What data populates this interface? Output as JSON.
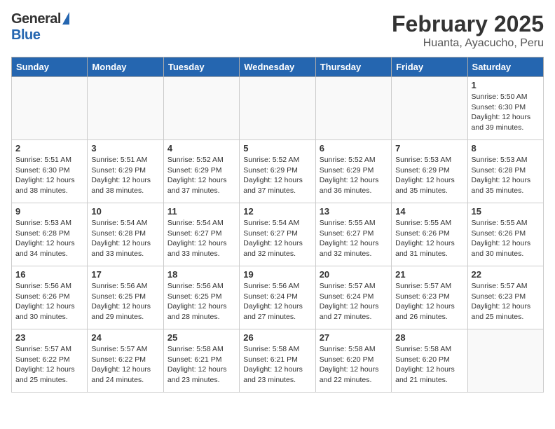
{
  "header": {
    "logo_general": "General",
    "logo_blue": "Blue",
    "month": "February 2025",
    "location": "Huanta, Ayacucho, Peru"
  },
  "days_of_week": [
    "Sunday",
    "Monday",
    "Tuesday",
    "Wednesday",
    "Thursday",
    "Friday",
    "Saturday"
  ],
  "weeks": [
    [
      {
        "day": "",
        "text": ""
      },
      {
        "day": "",
        "text": ""
      },
      {
        "day": "",
        "text": ""
      },
      {
        "day": "",
        "text": ""
      },
      {
        "day": "",
        "text": ""
      },
      {
        "day": "",
        "text": ""
      },
      {
        "day": "1",
        "text": "Sunrise: 5:50 AM\nSunset: 6:30 PM\nDaylight: 12 hours and 39 minutes."
      }
    ],
    [
      {
        "day": "2",
        "text": "Sunrise: 5:51 AM\nSunset: 6:30 PM\nDaylight: 12 hours and 38 minutes."
      },
      {
        "day": "3",
        "text": "Sunrise: 5:51 AM\nSunset: 6:29 PM\nDaylight: 12 hours and 38 minutes."
      },
      {
        "day": "4",
        "text": "Sunrise: 5:52 AM\nSunset: 6:29 PM\nDaylight: 12 hours and 37 minutes."
      },
      {
        "day": "5",
        "text": "Sunrise: 5:52 AM\nSunset: 6:29 PM\nDaylight: 12 hours and 37 minutes."
      },
      {
        "day": "6",
        "text": "Sunrise: 5:52 AM\nSunset: 6:29 PM\nDaylight: 12 hours and 36 minutes."
      },
      {
        "day": "7",
        "text": "Sunrise: 5:53 AM\nSunset: 6:29 PM\nDaylight: 12 hours and 35 minutes."
      },
      {
        "day": "8",
        "text": "Sunrise: 5:53 AM\nSunset: 6:28 PM\nDaylight: 12 hours and 35 minutes."
      }
    ],
    [
      {
        "day": "9",
        "text": "Sunrise: 5:53 AM\nSunset: 6:28 PM\nDaylight: 12 hours and 34 minutes."
      },
      {
        "day": "10",
        "text": "Sunrise: 5:54 AM\nSunset: 6:28 PM\nDaylight: 12 hours and 33 minutes."
      },
      {
        "day": "11",
        "text": "Sunrise: 5:54 AM\nSunset: 6:27 PM\nDaylight: 12 hours and 33 minutes."
      },
      {
        "day": "12",
        "text": "Sunrise: 5:54 AM\nSunset: 6:27 PM\nDaylight: 12 hours and 32 minutes."
      },
      {
        "day": "13",
        "text": "Sunrise: 5:55 AM\nSunset: 6:27 PM\nDaylight: 12 hours and 32 minutes."
      },
      {
        "day": "14",
        "text": "Sunrise: 5:55 AM\nSunset: 6:26 PM\nDaylight: 12 hours and 31 minutes."
      },
      {
        "day": "15",
        "text": "Sunrise: 5:55 AM\nSunset: 6:26 PM\nDaylight: 12 hours and 30 minutes."
      }
    ],
    [
      {
        "day": "16",
        "text": "Sunrise: 5:56 AM\nSunset: 6:26 PM\nDaylight: 12 hours and 30 minutes."
      },
      {
        "day": "17",
        "text": "Sunrise: 5:56 AM\nSunset: 6:25 PM\nDaylight: 12 hours and 29 minutes."
      },
      {
        "day": "18",
        "text": "Sunrise: 5:56 AM\nSunset: 6:25 PM\nDaylight: 12 hours and 28 minutes."
      },
      {
        "day": "19",
        "text": "Sunrise: 5:56 AM\nSunset: 6:24 PM\nDaylight: 12 hours and 27 minutes."
      },
      {
        "day": "20",
        "text": "Sunrise: 5:57 AM\nSunset: 6:24 PM\nDaylight: 12 hours and 27 minutes."
      },
      {
        "day": "21",
        "text": "Sunrise: 5:57 AM\nSunset: 6:23 PM\nDaylight: 12 hours and 26 minutes."
      },
      {
        "day": "22",
        "text": "Sunrise: 5:57 AM\nSunset: 6:23 PM\nDaylight: 12 hours and 25 minutes."
      }
    ],
    [
      {
        "day": "23",
        "text": "Sunrise: 5:57 AM\nSunset: 6:22 PM\nDaylight: 12 hours and 25 minutes."
      },
      {
        "day": "24",
        "text": "Sunrise: 5:57 AM\nSunset: 6:22 PM\nDaylight: 12 hours and 24 minutes."
      },
      {
        "day": "25",
        "text": "Sunrise: 5:58 AM\nSunset: 6:21 PM\nDaylight: 12 hours and 23 minutes."
      },
      {
        "day": "26",
        "text": "Sunrise: 5:58 AM\nSunset: 6:21 PM\nDaylight: 12 hours and 23 minutes."
      },
      {
        "day": "27",
        "text": "Sunrise: 5:58 AM\nSunset: 6:20 PM\nDaylight: 12 hours and 22 minutes."
      },
      {
        "day": "28",
        "text": "Sunrise: 5:58 AM\nSunset: 6:20 PM\nDaylight: 12 hours and 21 minutes."
      },
      {
        "day": "",
        "text": ""
      }
    ]
  ]
}
